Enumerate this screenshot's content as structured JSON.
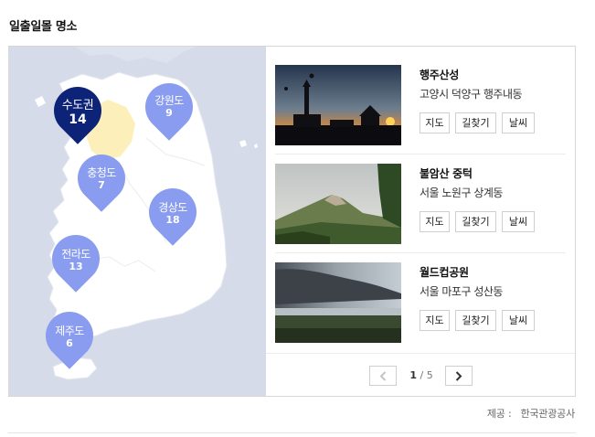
{
  "widget": {
    "title": "일출일몰 명소"
  },
  "colors": {
    "pin_active": "#0d2378",
    "pin_normal": "#8a9cef",
    "map_sea": "#dde3ee",
    "map_land": "#ffffff",
    "map_highlight": "#fdefb9"
  },
  "regions": [
    {
      "name": "수도권",
      "count": "14",
      "active": true
    },
    {
      "name": "강원도",
      "count": "9",
      "active": false
    },
    {
      "name": "충청도",
      "count": "7",
      "active": false
    },
    {
      "name": "경상도",
      "count": "18",
      "active": false
    },
    {
      "name": "전라도",
      "count": "13",
      "active": false
    },
    {
      "name": "제주도",
      "count": "6",
      "active": false
    }
  ],
  "spots": [
    {
      "name": "행주산성",
      "address": "고양시 덕양구 행주내동",
      "image": "sunset-silhouette-photo"
    },
    {
      "name": "불암산 중턱",
      "address": "서울 노원구 상계동",
      "image": "mountain-peak-photo"
    },
    {
      "name": "월드컵공원",
      "address": "서울 마포구 성산동",
      "image": "cloudy-river-photo"
    }
  ],
  "buttons": {
    "map": "지도",
    "route": "길찾기",
    "weather": "날씨"
  },
  "pagination": {
    "current": "1",
    "separator": "/",
    "total": "5",
    "prev_icon": "chevron-left-icon",
    "next_icon": "chevron-right-icon"
  },
  "source": {
    "label": "제공 :",
    "provider": "한국관광공사"
  }
}
